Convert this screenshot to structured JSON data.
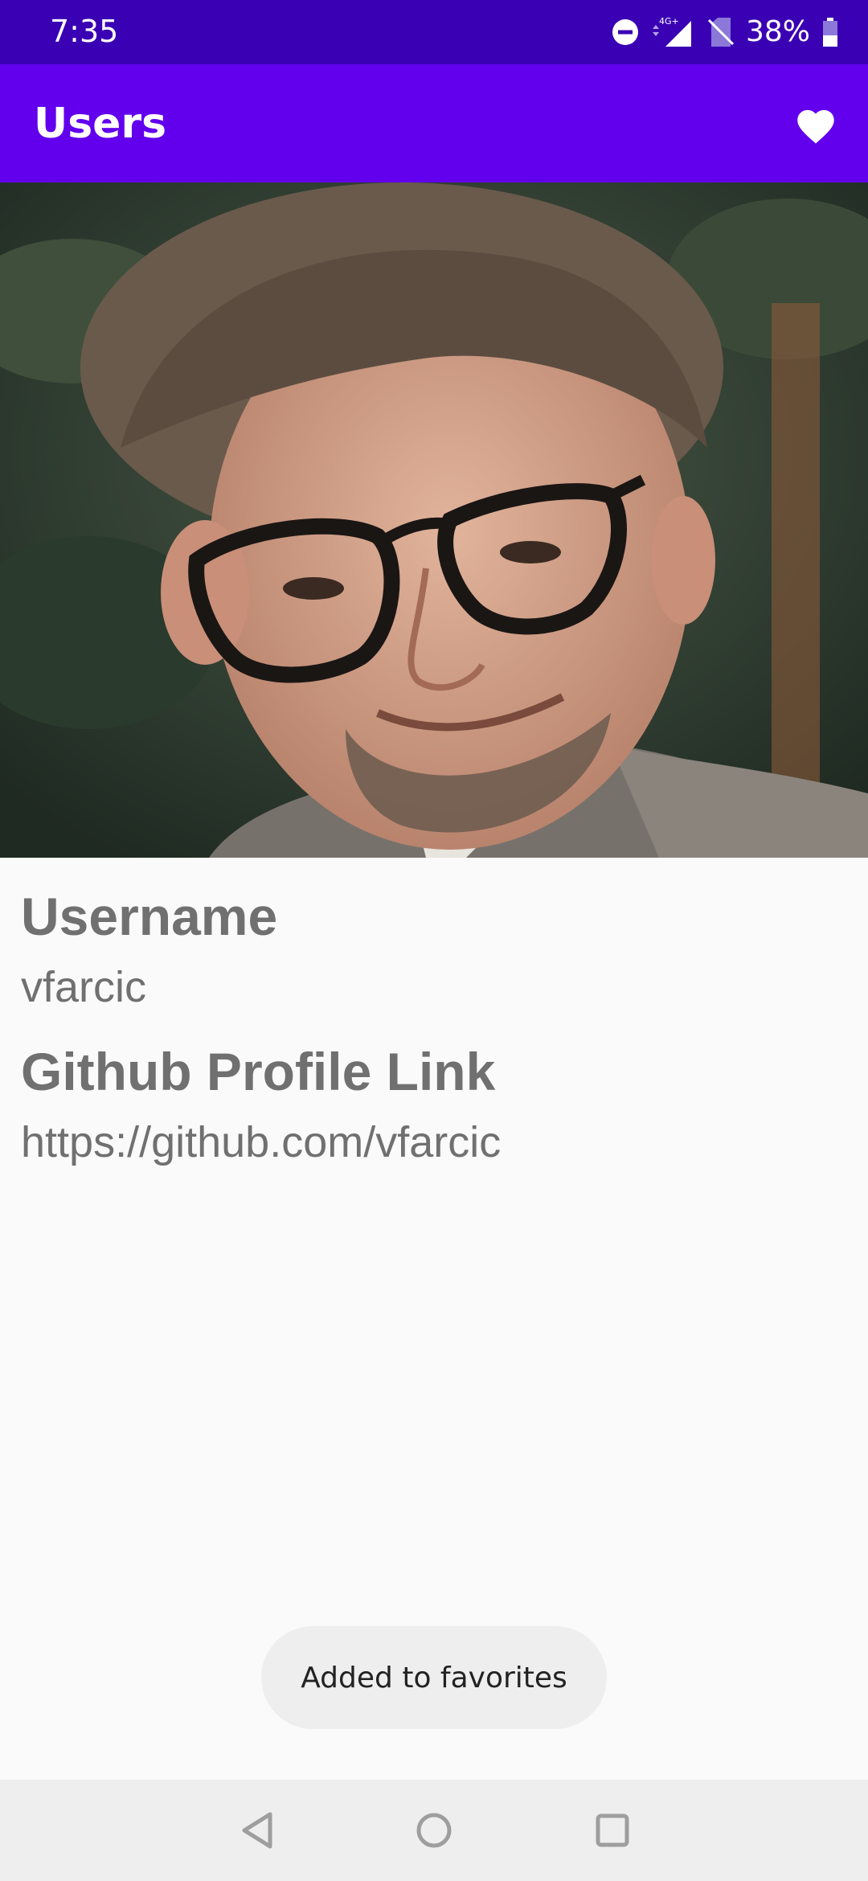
{
  "status_bar": {
    "time": "7:35",
    "network": "4G+",
    "battery": "38%",
    "icons": [
      "do-not-disturb-icon",
      "signal-icon",
      "no-sim-icon",
      "battery-icon"
    ]
  },
  "app_bar": {
    "title": "Users",
    "favorite_icon": "heart-icon"
  },
  "profile": {
    "username_label": "Username",
    "username": "vfarcic",
    "github_label": "Github Profile Link",
    "github_url": "https://github.com/vfarcic"
  },
  "toast": {
    "message": "Added to favorites"
  },
  "nav_bar": {
    "icons": [
      "back-icon",
      "home-icon",
      "recents-icon"
    ]
  },
  "colors": {
    "status_bar": "#3a00b4",
    "app_bar": "#6200ee",
    "background": "#fafafa",
    "text_gray": "#707070"
  }
}
